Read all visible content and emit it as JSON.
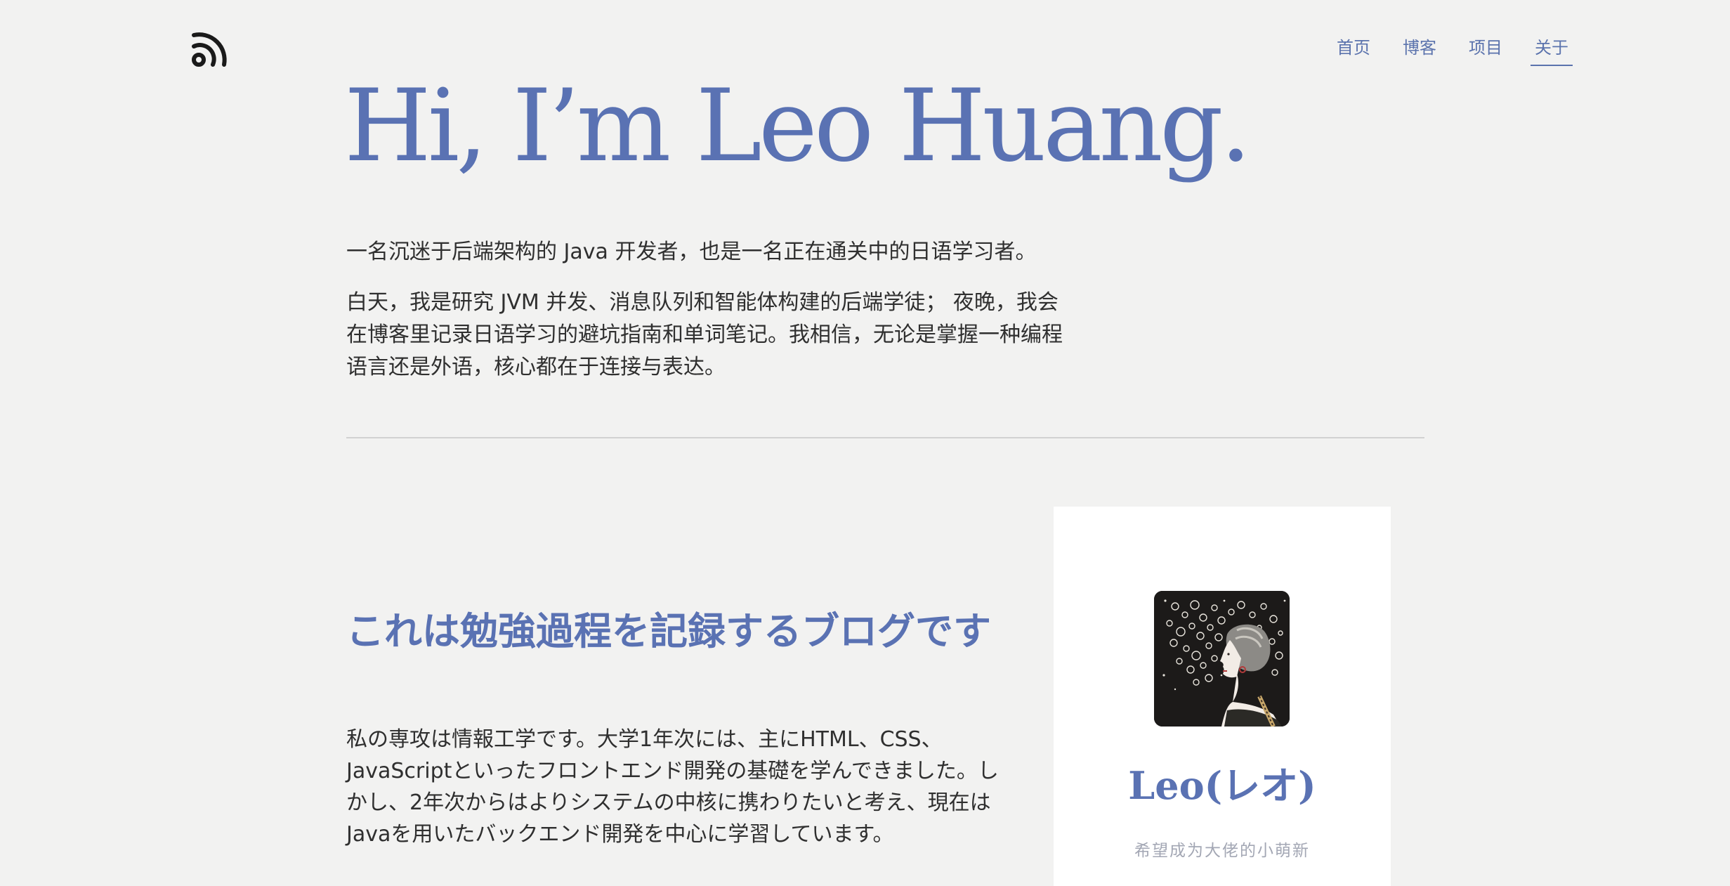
{
  "header": {
    "logo_icon": "rss-feed-icon",
    "nav": [
      {
        "label": "首页",
        "active": false
      },
      {
        "label": "博客",
        "active": false
      },
      {
        "label": "项目",
        "active": false
      },
      {
        "label": "关于",
        "active": true
      }
    ]
  },
  "hero": {
    "title": "Hi, I’m Leo Huang.",
    "intro_1": "一名沉迷于后端架构的 Java 开发者，也是一名正在通关中的日语学习者。",
    "intro_2": "白天，我是研究 JVM 并发、消息队列和智能体构建的后端学徒； 夜晚，我会在博客里记录日语学习的避坑指南和单词笔记。我相信，无论是掌握一种编程语言还是外语，核心都在于连接与表达。"
  },
  "blog": {
    "title": "これは勉強過程を記録するブログです",
    "body": "私の専攻は情報工学です。大学1年次には、主にHTML、CSS、JavaScriptといったフロントエンド開発の基礎を学んできました。しかし、2年次からはよりシステムの中核に携わりたいと考え、現在はJavaを用いたバックエンド開発を中心に学習しています。"
  },
  "profile": {
    "avatar_icon": "art-deco-portrait-avatar",
    "name": "Leo(レオ)",
    "motto": "希望成为大佬的小萌新"
  },
  "colors": {
    "background": "#f2f2f1",
    "accent": "#5a72b3",
    "text": "#2f2f2f",
    "card": "#ffffff",
    "muted": "#a3a7b4"
  }
}
